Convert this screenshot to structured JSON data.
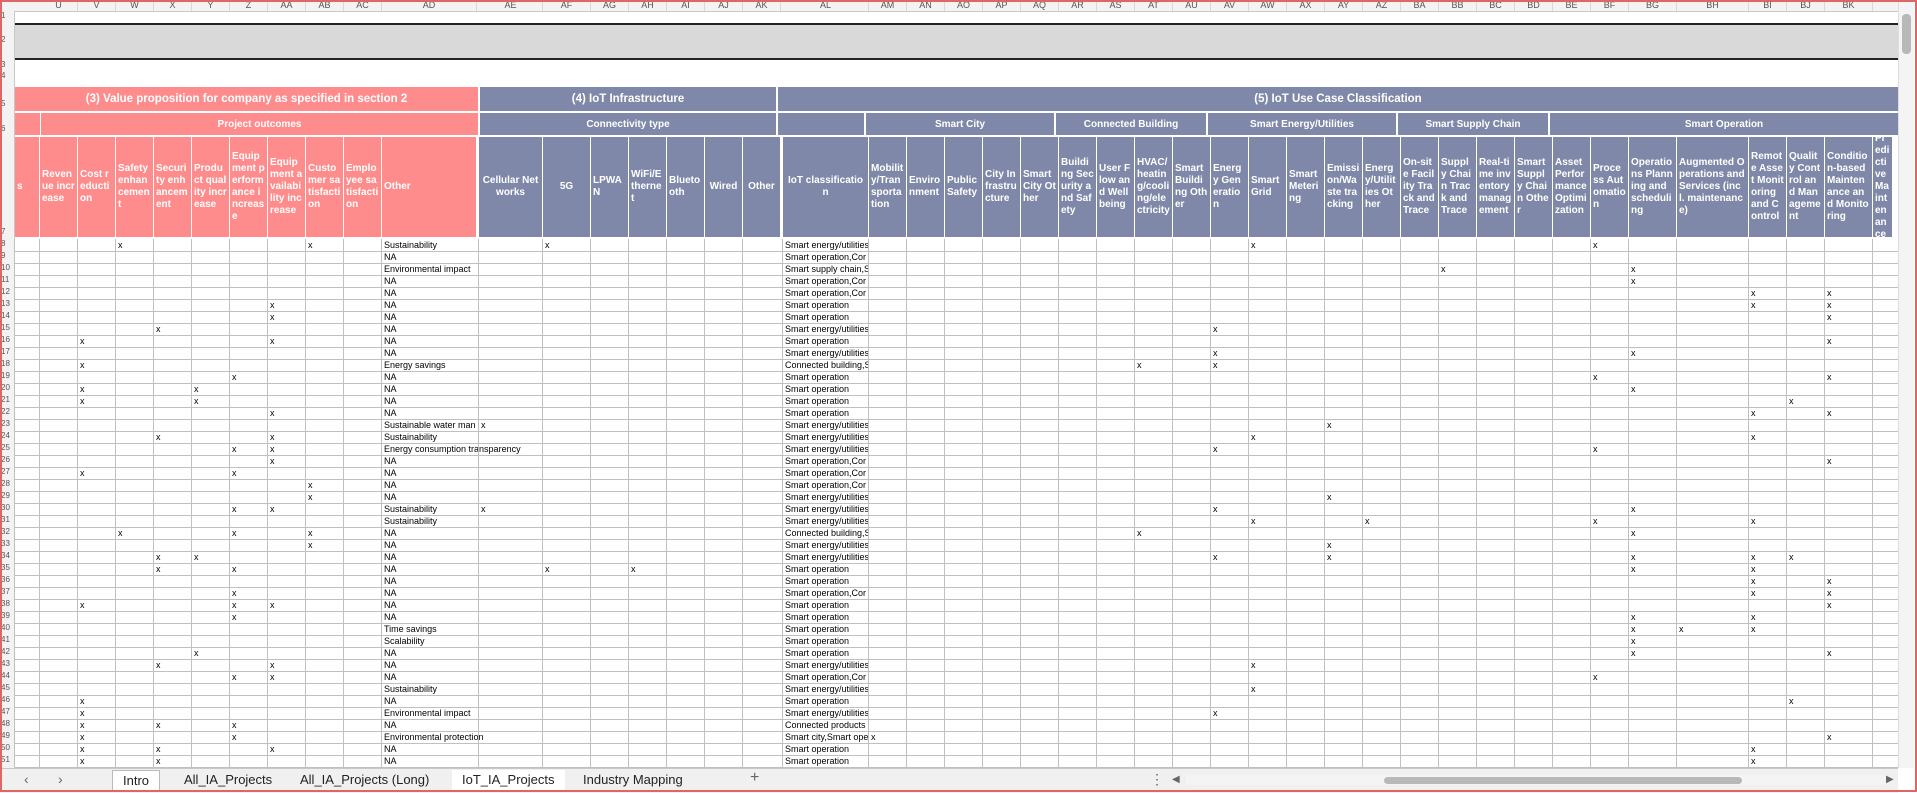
{
  "column_letters": [
    "U",
    "V",
    "W",
    "X",
    "Y",
    "Z",
    "AA",
    "AB",
    "AC",
    "AD",
    "AE",
    "AF",
    "AG",
    "AH",
    "AI",
    "AJ",
    "AK",
    "AL",
    "AM",
    "AN",
    "AO",
    "AP",
    "AQ",
    "AR",
    "AS",
    "AT",
    "AU",
    "AV",
    "AW",
    "AX",
    "AY",
    "AZ",
    "BA",
    "BB",
    "BC",
    "BD",
    "BE",
    "BF",
    "BG",
    "BH",
    "BI",
    "BJ",
    "BK"
  ],
  "sections": {
    "value_prop": "(3) Value proposition for company as specified in section 2",
    "iot_infra": "(4) IoT Infrastructure",
    "iot_usecase": "(5) IoT Use Case Classification"
  },
  "subsections": {
    "project_outcomes": "Project outcomes",
    "connectivity": "Connectivity type",
    "smart_city": "Smart City",
    "connected_building": "Connected Building",
    "smart_energy": "Smart Energy/Utilities",
    "smart_supply": "Smart Supply Chain",
    "smart_operation": "Smart Operation"
  },
  "headers": [
    "s",
    "Revenue increase",
    "Cost reduction",
    "Safety enhancement",
    "Security enhancement",
    "Product quality increase",
    "Equipment performance increase",
    "Equipment availability increase",
    "Customer satisfaction",
    "Employee satisfaction",
    "Other",
    "Cellular Networks",
    "5G",
    "LPWAN",
    "WiFi/Ethernet",
    "Bluetooth",
    "Wired",
    "Other",
    "IoT classification",
    "Mobility/Transportation",
    "Environment",
    "Public Safety",
    "City Infrastructure",
    "Smart City Other",
    "Building Security and Safety",
    "User Flow and Wellbeing",
    "HVAC/heating/cooling/electricity",
    "Smart Building Other",
    "Energy Generation",
    "Smart Grid",
    "Smart Metering",
    "Emission/Waste tracking",
    "Energy/Utilities Other",
    "On-site Facility Track and Trace",
    "Supply Chain Track and Trace",
    "Real-time inventory management",
    "Smart Supply Chain Other",
    "Asset Performance Optimization",
    "Process Automation",
    "Operations Planning and scheduling",
    "Augmented Operations and Services (incl. maintenance)",
    "Remote Asset Monitoring and Control",
    "Quality Control and Management",
    "Condition-based Maintenance and Monitoring",
    "Predictive Maintenance"
  ],
  "row_numbers": [
    "1",
    "2",
    "3",
    "4",
    "5",
    "6",
    "7",
    "8",
    "9",
    "10",
    "11",
    "12",
    "13",
    "14",
    "15",
    "16",
    "17",
    "18",
    "19",
    "20",
    "21",
    "22",
    "23",
    "24",
    "25",
    "26",
    "27",
    "28",
    "29",
    "30",
    "31",
    "32",
    "33",
    "34",
    "35",
    "36",
    "37",
    "38",
    "39",
    "40",
    "41",
    "42",
    "43",
    "44",
    "45",
    "46",
    "47",
    "48",
    "49",
    "50",
    "51"
  ],
  "rows": [
    {
      "other": "Sustainability",
      "cls": "Smart energy/utilities",
      "x": [
        3,
        8,
        12,
        29,
        38
      ]
    },
    {
      "other": "NA",
      "cls": "Smart operation,Cor",
      "x": [
        45
      ]
    },
    {
      "other": "Environmental impact",
      "cls": "Smart supply chain,S",
      "x": [
        34,
        39
      ]
    },
    {
      "other": "NA",
      "cls": "Smart operation,Cor",
      "x": [
        39
      ]
    },
    {
      "other": "NA",
      "cls": "Smart operation,Cor",
      "x": [
        41,
        43,
        45
      ]
    },
    {
      "other": "NA",
      "cls": "Smart operation",
      "x": [
        7,
        41,
        43
      ]
    },
    {
      "other": "NA",
      "cls": "Smart operation",
      "x": [
        7,
        43
      ]
    },
    {
      "other": "NA",
      "cls": "Smart energy/utilities",
      "x": [
        4,
        28
      ]
    },
    {
      "other": "NA",
      "cls": "Smart operation",
      "x": [
        2,
        7,
        43
      ]
    },
    {
      "other": "NA",
      "cls": "Smart energy/utilities",
      "x": [
        28,
        39
      ]
    },
    {
      "other": "Energy savings",
      "cls": "Connected building,S",
      "x": [
        2,
        26,
        28
      ]
    },
    {
      "other": "NA",
      "cls": "Smart operation",
      "x": [
        6,
        38,
        43
      ]
    },
    {
      "other": "NA",
      "cls": "Smart operation",
      "x": [
        2,
        5,
        39
      ]
    },
    {
      "other": "NA",
      "cls": "Smart operation",
      "x": [
        2,
        5,
        42
      ]
    },
    {
      "other": "NA",
      "cls": "Smart operation",
      "x": [
        7,
        41,
        43
      ]
    },
    {
      "other": "Sustainable water man",
      "cls": "Smart energy/utilities",
      "x": [
        11,
        31,
        45
      ]
    },
    {
      "other": "Sustainability",
      "cls": "Smart energy/utilities",
      "x": [
        4,
        7,
        29,
        41
      ]
    },
    {
      "other": "Energy consumption transparency",
      "cls": "Smart energy/utilities",
      "x": [
        6,
        7,
        28,
        38
      ]
    },
    {
      "other": "NA",
      "cls": "Smart operation,Cor",
      "x": [
        7,
        43,
        45
      ]
    },
    {
      "other": "NA",
      "cls": "Smart operation,Cor",
      "x": [
        2,
        6,
        45
      ]
    },
    {
      "other": "NA",
      "cls": "Smart operation,Cor",
      "x": [
        8,
        45
      ]
    },
    {
      "other": "NA",
      "cls": "Smart energy/utilities",
      "x": [
        8,
        31
      ]
    },
    {
      "other": "Sustainability",
      "cls": "Smart energy/utilities",
      "x": [
        6,
        7,
        11,
        28,
        39,
        45
      ]
    },
    {
      "other": "Sustainability",
      "cls": "Smart energy/utilities",
      "x": [
        29,
        32,
        38,
        41
      ]
    },
    {
      "other": "NA",
      "cls": "Connected building,S",
      "x": [
        3,
        6,
        8,
        26,
        39
      ]
    },
    {
      "other": "NA",
      "cls": "Smart energy/utilities",
      "x": [
        8,
        31
      ]
    },
    {
      "other": "NA",
      "cls": "Smart energy/utilities",
      "x": [
        4,
        5,
        28,
        31,
        39,
        41,
        42
      ]
    },
    {
      "other": "NA",
      "cls": "Smart operation",
      "x": [
        4,
        6,
        12,
        14,
        39,
        41
      ]
    },
    {
      "other": "NA",
      "cls": "Smart operation",
      "x": [
        41,
        43
      ]
    },
    {
      "other": "NA",
      "cls": "Smart operation,Cor",
      "x": [
        6,
        41,
        43
      ]
    },
    {
      "other": "NA",
      "cls": "Smart operation",
      "x": [
        2,
        6,
        7,
        43
      ]
    },
    {
      "other": "NA",
      "cls": "Smart operation",
      "x": [
        6,
        39,
        41
      ]
    },
    {
      "other": "Time savings",
      "cls": "Smart operation",
      "x": [
        39,
        40,
        41
      ]
    },
    {
      "other": "Scalability",
      "cls": "Smart operation",
      "x": [
        39
      ]
    },
    {
      "other": "NA",
      "cls": "Smart operation",
      "x": [
        5,
        39,
        43
      ]
    },
    {
      "other": "NA",
      "cls": "Smart energy/utilities",
      "x": [
        4,
        7,
        29
      ]
    },
    {
      "other": "NA",
      "cls": "Smart operation,Cor",
      "x": [
        6,
        7,
        38,
        45
      ]
    },
    {
      "other": "Sustainability",
      "cls": "Smart energy/utilities",
      "x": [
        29
      ]
    },
    {
      "other": "NA",
      "cls": "Smart operation",
      "x": [
        2,
        42
      ]
    },
    {
      "other": "Environmental impact",
      "cls": "Smart energy/utilities",
      "x": [
        2,
        28
      ]
    },
    {
      "other": "NA",
      "cls": "Connected products",
      "x": [
        2,
        4,
        6
      ]
    },
    {
      "other": "Environmental protection",
      "cls": "Smart city,Smart ope",
      "x": [
        2,
        6,
        19,
        43
      ]
    },
    {
      "other": "NA",
      "cls": "Smart operation",
      "x": [
        2,
        4,
        7,
        41
      ]
    },
    {
      "other": "NA",
      "cls": "Smart operation",
      "x": [
        2,
        4,
        41
      ]
    }
  ],
  "cell_mark": "x",
  "sheet_tabs": [
    "Intro",
    "All_IA_Projects",
    "All_IA_Projects (Long)",
    "IoT_IA_Projects",
    "Industry Mapping"
  ],
  "active_tab": "IoT_IA_Projects",
  "nav": {
    "prev": "‹",
    "next": "›",
    "add": "+",
    "menu": "⋮",
    "left": "◀",
    "right": "▶"
  },
  "colors": {
    "red_header": "#ff8c8c",
    "blue_header": "#7f88a8",
    "tab_active_underline": "#2f7d32",
    "frame": "#e06666"
  }
}
